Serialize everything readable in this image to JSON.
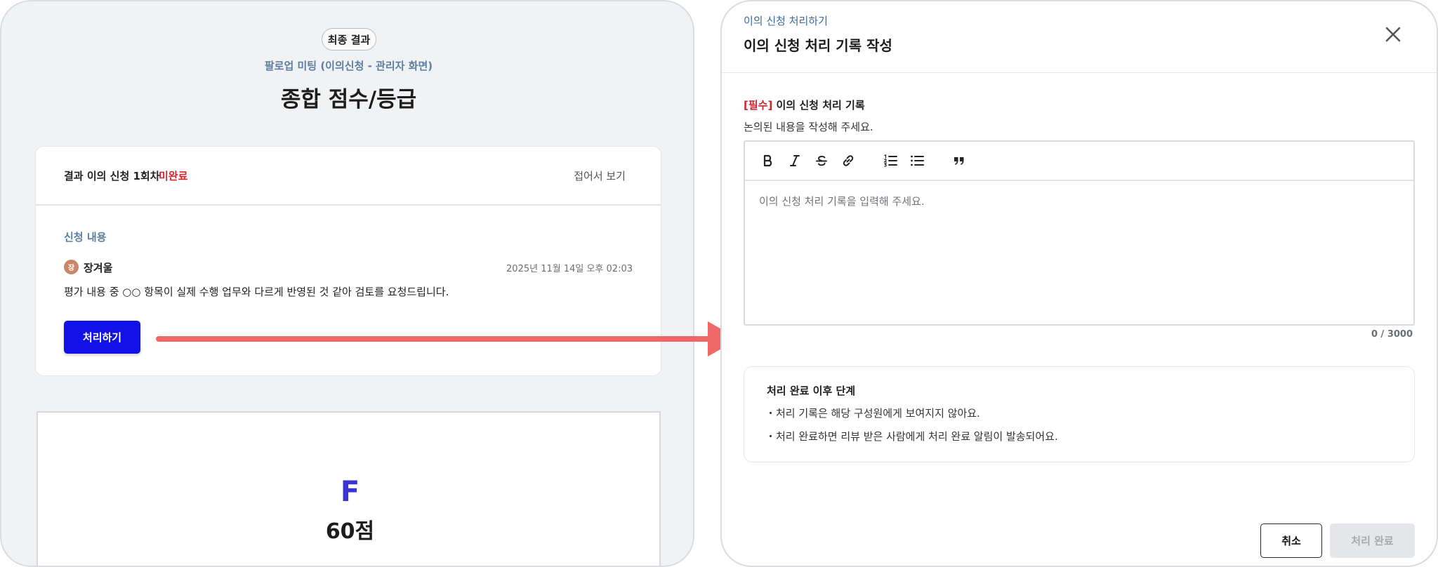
{
  "left": {
    "badge": "최종 결과",
    "subtitle": "팔로업 미팅 (이의신청 - 관리자 화면)",
    "title": "종합 점수/등급",
    "appeal_card": {
      "title": "결과 이의 신청 1회차",
      "status": "미완료",
      "fold_label": "접어서 보기",
      "section_label": "신청 내용",
      "author_initial": "장",
      "author_name": "장겨울",
      "timestamp": "2025년 11월 14일 오후 02:03",
      "body": "평가 내용 중 ○○ 항목이 실제 수행 업무와 다르게 반영된 것 같아 검토를 요청드립니다.",
      "process_button": "처리하기"
    },
    "grade_card": {
      "grade": "F",
      "score": "60점"
    }
  },
  "modal": {
    "eyebrow": "이의 신청 처리하기",
    "title": "이의 신청 처리 기록 작성",
    "field": {
      "required_tag": "[필수]",
      "label": "이의 신청 처리 기록",
      "helper": "논의된 내용을 작성해 주세요.",
      "placeholder": "이의 신청 처리 기록을 입력해 주세요.",
      "value": "",
      "char_count": "0 / 3000"
    },
    "toolbar_icons": [
      "bold-icon",
      "italic-icon",
      "strikethrough-icon",
      "link-icon",
      "ordered-list-icon",
      "bullet-list-icon",
      "quote-icon"
    ],
    "info": {
      "title": "처리 완료 이후 단계",
      "items": [
        "・처리 기록은 해당 구성원에게 보여지지 않아요.",
        "・처리 완료하면 리뷰 받은 사람에게 처리 완료 알림이 발송되어요."
      ]
    },
    "buttons": {
      "cancel": "취소",
      "complete": "처리 완료"
    }
  },
  "colors": {
    "primary_button": "#1212e6",
    "status_incomplete": "#d3232f",
    "grade_letter": "#3a35d1",
    "arrow": "#f06767",
    "accent_label": "#5d7ea0"
  }
}
